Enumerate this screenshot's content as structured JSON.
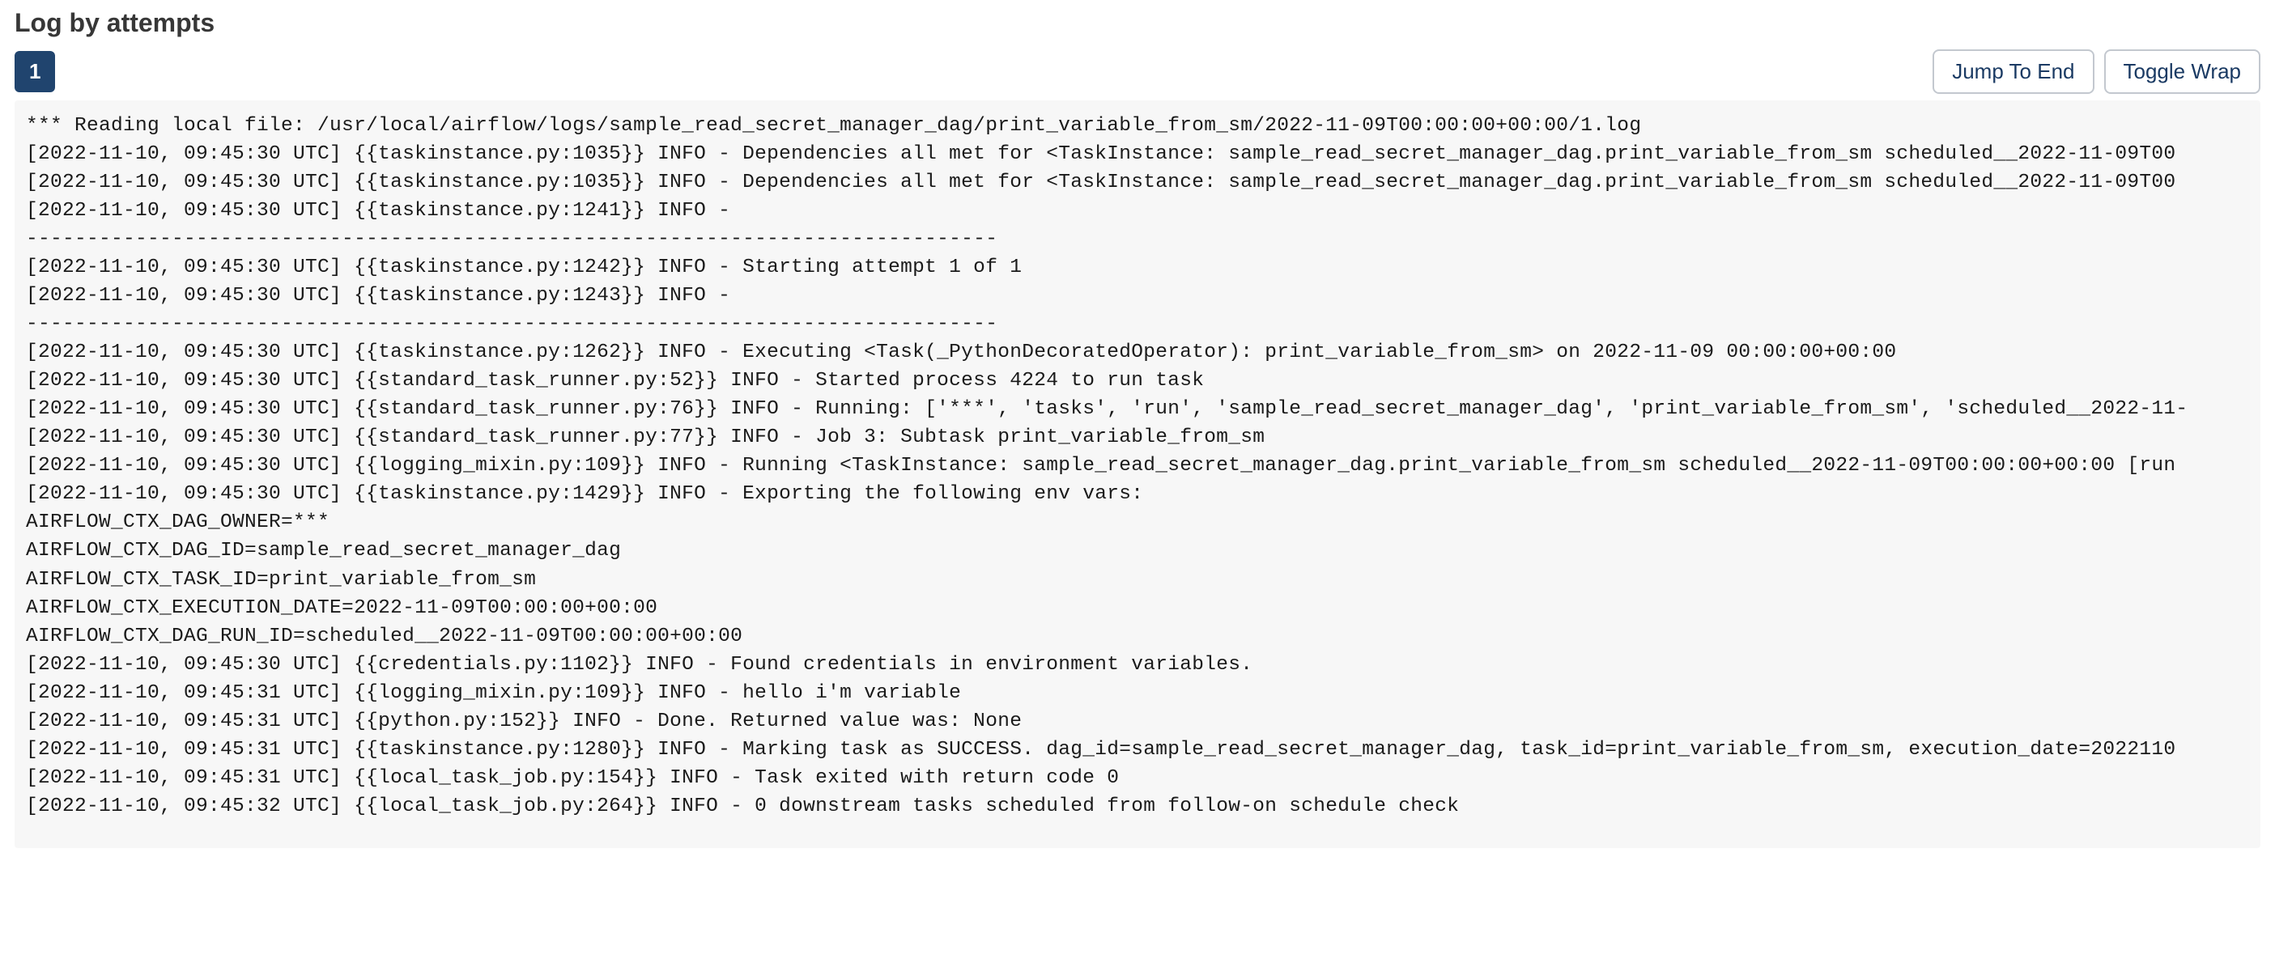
{
  "header": {
    "title": "Log by attempts"
  },
  "tabs": {
    "attempts": [
      "1"
    ]
  },
  "buttons": {
    "jump_to_end": "Jump To End",
    "toggle_wrap": "Toggle Wrap"
  },
  "log": {
    "lines": [
      "*** Reading local file: /usr/local/airflow/logs/sample_read_secret_manager_dag/print_variable_from_sm/2022-11-09T00:00:00+00:00/1.log",
      "[2022-11-10, 09:45:30 UTC] {{taskinstance.py:1035}} INFO - Dependencies all met for <TaskInstance: sample_read_secret_manager_dag.print_variable_from_sm scheduled__2022-11-09T00",
      "[2022-11-10, 09:45:30 UTC] {{taskinstance.py:1035}} INFO - Dependencies all met for <TaskInstance: sample_read_secret_manager_dag.print_variable_from_sm scheduled__2022-11-09T00",
      "[2022-11-10, 09:45:30 UTC] {{taskinstance.py:1241}} INFO - ",
      "--------------------------------------------------------------------------------",
      "[2022-11-10, 09:45:30 UTC] {{taskinstance.py:1242}} INFO - Starting attempt 1 of 1",
      "[2022-11-10, 09:45:30 UTC] {{taskinstance.py:1243}} INFO - ",
      "--------------------------------------------------------------------------------",
      "[2022-11-10, 09:45:30 UTC] {{taskinstance.py:1262}} INFO - Executing <Task(_PythonDecoratedOperator): print_variable_from_sm> on 2022-11-09 00:00:00+00:00",
      "[2022-11-10, 09:45:30 UTC] {{standard_task_runner.py:52}} INFO - Started process 4224 to run task",
      "[2022-11-10, 09:45:30 UTC] {{standard_task_runner.py:76}} INFO - Running: ['***', 'tasks', 'run', 'sample_read_secret_manager_dag', 'print_variable_from_sm', 'scheduled__2022-11-",
      "[2022-11-10, 09:45:30 UTC] {{standard_task_runner.py:77}} INFO - Job 3: Subtask print_variable_from_sm",
      "[2022-11-10, 09:45:30 UTC] {{logging_mixin.py:109}} INFO - Running <TaskInstance: sample_read_secret_manager_dag.print_variable_from_sm scheduled__2022-11-09T00:00:00+00:00 [run",
      "[2022-11-10, 09:45:30 UTC] {{taskinstance.py:1429}} INFO - Exporting the following env vars:",
      "AIRFLOW_CTX_DAG_OWNER=***",
      "AIRFLOW_CTX_DAG_ID=sample_read_secret_manager_dag",
      "AIRFLOW_CTX_TASK_ID=print_variable_from_sm",
      "AIRFLOW_CTX_EXECUTION_DATE=2022-11-09T00:00:00+00:00",
      "AIRFLOW_CTX_DAG_RUN_ID=scheduled__2022-11-09T00:00:00+00:00",
      "[2022-11-10, 09:45:30 UTC] {{credentials.py:1102}} INFO - Found credentials in environment variables.",
      "[2022-11-10, 09:45:31 UTC] {{logging_mixin.py:109}} INFO - hello i'm variable",
      "[2022-11-10, 09:45:31 UTC] {{python.py:152}} INFO - Done. Returned value was: None",
      "[2022-11-10, 09:45:31 UTC] {{taskinstance.py:1280}} INFO - Marking task as SUCCESS. dag_id=sample_read_secret_manager_dag, task_id=print_variable_from_sm, execution_date=2022110",
      "[2022-11-10, 09:45:31 UTC] {{local_task_job.py:154}} INFO - Task exited with return code 0",
      "[2022-11-10, 09:45:32 UTC] {{local_task_job.py:264}} INFO - 0 downstream tasks scheduled from follow-on schedule check"
    ]
  }
}
